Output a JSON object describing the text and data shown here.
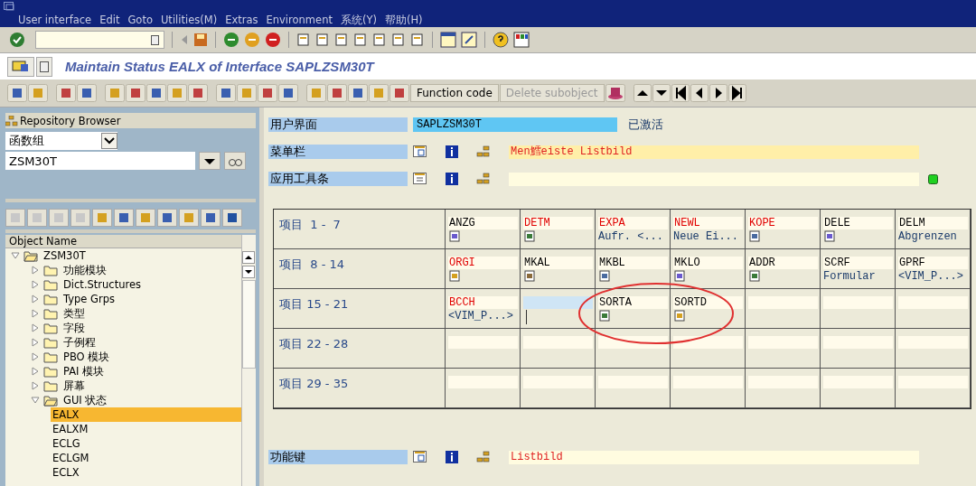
{
  "menu_bar": [
    {
      "label": "User interface"
    },
    {
      "label": "Edit"
    },
    {
      "label": "Goto"
    },
    {
      "label": "Utilities(M)"
    },
    {
      "label": "Extras"
    },
    {
      "label": "Environment"
    },
    {
      "label": "系统(Y)"
    },
    {
      "label": "帮助(H)"
    }
  ],
  "title": "Maintain Status EALX of Interface SAPLZSM30T",
  "app_toolbar": [
    {
      "label": "Function code",
      "disabled": false
    },
    {
      "label": "Delete subobject",
      "disabled": true
    }
  ],
  "repository_browser": {
    "title": "Repository Browser",
    "object_type": "函数组",
    "object_name": "ZSM30T",
    "tree_header": "Object Name",
    "tree": [
      {
        "label": "ZSM30T",
        "expanded": true,
        "selected": false,
        "children": [
          {
            "label": "功能模块",
            "expanded": false,
            "selected": false
          },
          {
            "label": "Dict.Structures",
            "expanded": false,
            "selected": false
          },
          {
            "label": "Type Grps",
            "expanded": false,
            "selected": false
          },
          {
            "label": "类型",
            "expanded": false,
            "selected": false
          },
          {
            "label": "字段",
            "expanded": false,
            "selected": false
          },
          {
            "label": "子例程",
            "expanded": false,
            "selected": false
          },
          {
            "label": "PBO 模块",
            "expanded": false,
            "selected": false
          },
          {
            "label": "PAI 模块",
            "expanded": false,
            "selected": false
          },
          {
            "label": "屏幕",
            "expanded": false,
            "selected": false
          },
          {
            "label": "GUI 状态",
            "expanded": true,
            "selected": false,
            "children": [
              {
                "label": "EALX",
                "selected": true
              },
              {
                "label": "EALXM",
                "selected": false
              },
              {
                "label": "ECLG",
                "selected": false
              },
              {
                "label": "ECLGM",
                "selected": false
              },
              {
                "label": "ECLX",
                "selected": false
              }
            ]
          }
        ]
      }
    ]
  },
  "interface": {
    "label": "用户界面",
    "value": "SAPLZSM30T",
    "status": "已激活"
  },
  "menu_bar_row": {
    "label": "菜单栏",
    "value": "Men鱈eiste Listbild"
  },
  "application_toolbar_row": {
    "label": "应用工具条"
  },
  "function_keys_row": {
    "label": "功能键",
    "value": "Listbild"
  },
  "table": {
    "rows": [
      {
        "label": "项目  1 -  7",
        "cells": [
          {
            "kind": "icon",
            "code": "ANZG",
            "color": "#000000",
            "selected": false
          },
          {
            "kind": "icon",
            "code": "DETM",
            "color": "#e00000",
            "selected": false
          },
          {
            "kind": "text",
            "code": "EXPA",
            "text": "Aufr. <...",
            "color": "#e00000",
            "selected": false
          },
          {
            "kind": "text",
            "code": "NEWL",
            "text": "Neue Ei...",
            "color": "#e00000",
            "selected": false
          },
          {
            "kind": "icon",
            "code": "KOPE",
            "color": "#e00000",
            "selected": false
          },
          {
            "kind": "icon",
            "code": "DELE",
            "color": "#000000",
            "selected": false
          },
          {
            "kind": "text",
            "code": "DELM",
            "text": "Abgrenzen",
            "color": "#000000",
            "selected": false
          }
        ]
      },
      {
        "label": "项目  8 - 14",
        "cells": [
          {
            "kind": "icon",
            "code": "ORGI",
            "color": "#e00000",
            "selected": false
          },
          {
            "kind": "icon",
            "code": "MKAL",
            "color": "#000000",
            "selected": false
          },
          {
            "kind": "icon",
            "code": "MKBL",
            "color": "#000000",
            "selected": false
          },
          {
            "kind": "icon",
            "code": "MKLO",
            "color": "#000000",
            "selected": false
          },
          {
            "kind": "icon",
            "code": "ADDR",
            "color": "#000000",
            "selected": false
          },
          {
            "kind": "text",
            "code": "SCRF",
            "text": "Formular",
            "color": "#000000",
            "selected": false
          },
          {
            "kind": "text",
            "code": "GPRF",
            "text": "<VIM_P...>",
            "color": "#000000",
            "selected": false
          }
        ]
      },
      {
        "label": "项目 15 - 21",
        "cells": [
          {
            "kind": "text",
            "code": "BCCH",
            "text": "<VIM_P...>",
            "color": "#e00000",
            "selected": false
          },
          {
            "kind": "empty",
            "selected": true
          },
          {
            "kind": "icon",
            "code": "SORTA",
            "color": "#000000",
            "selected": false
          },
          {
            "kind": "icon",
            "code": "SORTD",
            "color": "#000000",
            "selected": false
          },
          {
            "kind": "empty",
            "selected": false
          },
          {
            "kind": "empty",
            "selected": false
          },
          {
            "kind": "empty",
            "selected": false
          }
        ]
      },
      {
        "label": "项目 22 - 28",
        "cells": [
          {
            "kind": "empty",
            "selected": false
          },
          {
            "kind": "empty",
            "selected": false
          },
          {
            "kind": "empty",
            "selected": false
          },
          {
            "kind": "empty",
            "selected": false
          },
          {
            "kind": "empty",
            "selected": false
          },
          {
            "kind": "empty",
            "selected": false
          },
          {
            "kind": "empty",
            "selected": false
          }
        ]
      },
      {
        "label": "项目 29 - 35",
        "cells": [
          {
            "kind": "empty",
            "selected": false
          },
          {
            "kind": "empty",
            "selected": false
          },
          {
            "kind": "empty",
            "selected": false
          },
          {
            "kind": "empty",
            "selected": false
          },
          {
            "kind": "empty",
            "selected": false
          },
          {
            "kind": "empty",
            "selected": false
          },
          {
            "kind": "empty",
            "selected": false
          }
        ]
      }
    ]
  }
}
